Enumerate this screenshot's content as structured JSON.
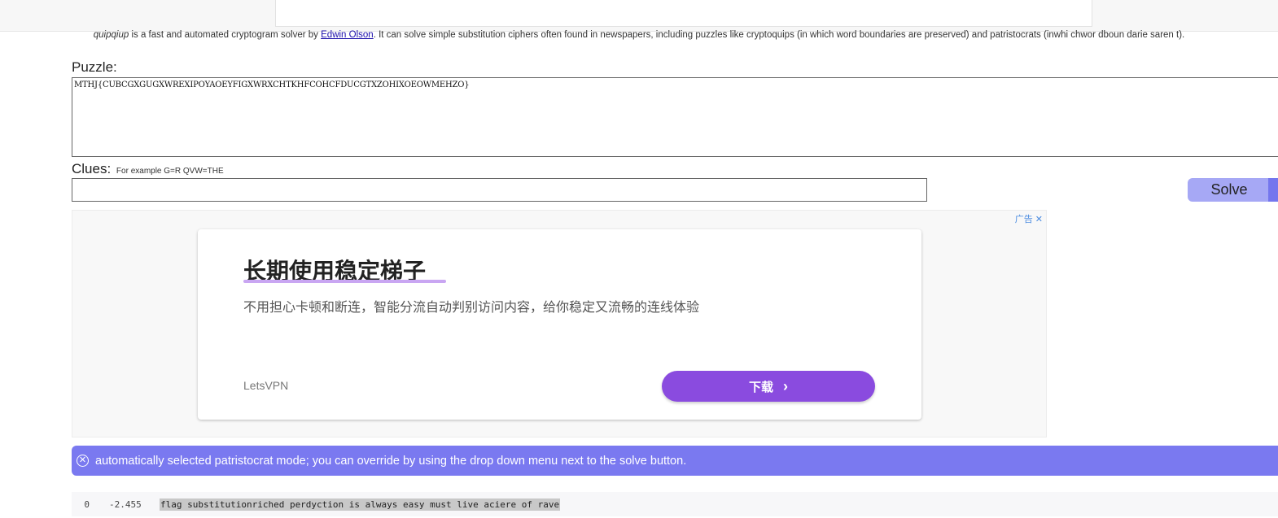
{
  "intro": {
    "app_name": "quipqiup",
    "text_before_link": " is a fast and automated cryptogram solver by ",
    "author_link": "Edwin Olson",
    "text_after_link": ". It can solve simple substitution ciphers often found in newspapers, including puzzles like cryptoquips (in which word boundaries are preserved) and patristocrats (inwhi chwor dboun darie saren t)."
  },
  "puzzle": {
    "label": "Puzzle:",
    "value": "MTHJ{CUBCGXGUGXWREXIPOYAOEYFIGXWRXCHTKHFCOHCFDUCGTXZOHIXOEOWMEHZO}"
  },
  "clues": {
    "label": "Clues:",
    "hint": "For example G=R QVW=THE",
    "value": ""
  },
  "solve_button": {
    "label": "Solve"
  },
  "ad": {
    "tag": "广告",
    "close_glyph": "✕",
    "title": "长期使用稳定梯子",
    "description": "不用担心卡顿和断连，智能分流自动判别访问内容，给你稳定又流畅的连线体验",
    "brand": "LetsVPN",
    "download_label": "下载",
    "chevron": "›"
  },
  "alert": {
    "icon": "close-circle-icon",
    "glyph": "✕",
    "message": "automatically selected patristocrat mode; you can override by using the drop down menu next to the solve button."
  },
  "results": [
    {
      "index": "0",
      "score": "-2.455",
      "text": "flag substitutionriched perdyction is always easy must live aciere of rave"
    }
  ]
}
